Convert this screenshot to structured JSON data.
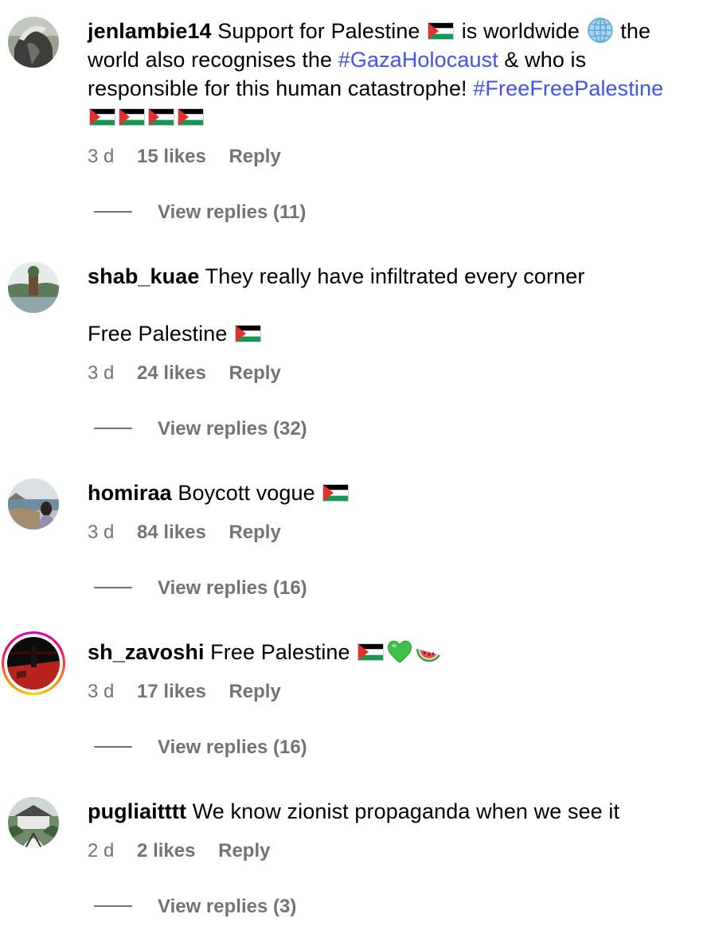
{
  "comments": [
    {
      "username": "jenlambie14",
      "text_1": "Support for Palestine",
      "text_2": "is worldwide",
      "text_3": "the world also recognises the",
      "hashtag_1": "#GazaHolocaust",
      "text_4": "& who is responsible for this human catastrophe!",
      "hashtag_2": "#FreeFreePalestine",
      "time": "3 d",
      "likes": "15 likes",
      "reply": "Reply",
      "view_replies": "View replies (11)",
      "emoji": [
        "palestine-flag",
        "globe-icon",
        "palestine-flag",
        "palestine-flag",
        "palestine-flag",
        "palestine-flag"
      ]
    },
    {
      "username": "shab_kuae",
      "text_1": "They really have infiltrated every corner",
      "text_2": "Free Palestine",
      "time": "3 d",
      "likes": "24 likes",
      "reply": "Reply",
      "view_replies": "View replies (32)",
      "emoji": [
        "palestine-flag"
      ]
    },
    {
      "username": "homiraa",
      "text_1": "Boycott vogue",
      "time": "3 d",
      "likes": "84 likes",
      "reply": "Reply",
      "view_replies": "View replies (16)",
      "emoji": [
        "palestine-flag"
      ]
    },
    {
      "username": "sh_zavoshi",
      "text_1": "Free Palestine",
      "time": "3 d",
      "likes": "17 likes",
      "reply": "Reply",
      "view_replies": "View replies (16)",
      "emoji": [
        "palestine-flag",
        "green-heart-icon",
        "watermelon-icon"
      ]
    },
    {
      "username": "pugliaitttt",
      "text_1": "We know zionist propaganda when we see it",
      "time": "2 d",
      "likes": "2 likes",
      "reply": "Reply",
      "view_replies": "View replies (3)",
      "emoji": []
    }
  ],
  "colors": {
    "text": "#000000",
    "meta": "#737373",
    "hashtag": "#4150f7",
    "story_ring": [
      "#d300c5",
      "#ff0069",
      "#ff7a00",
      "#ffd600"
    ]
  }
}
